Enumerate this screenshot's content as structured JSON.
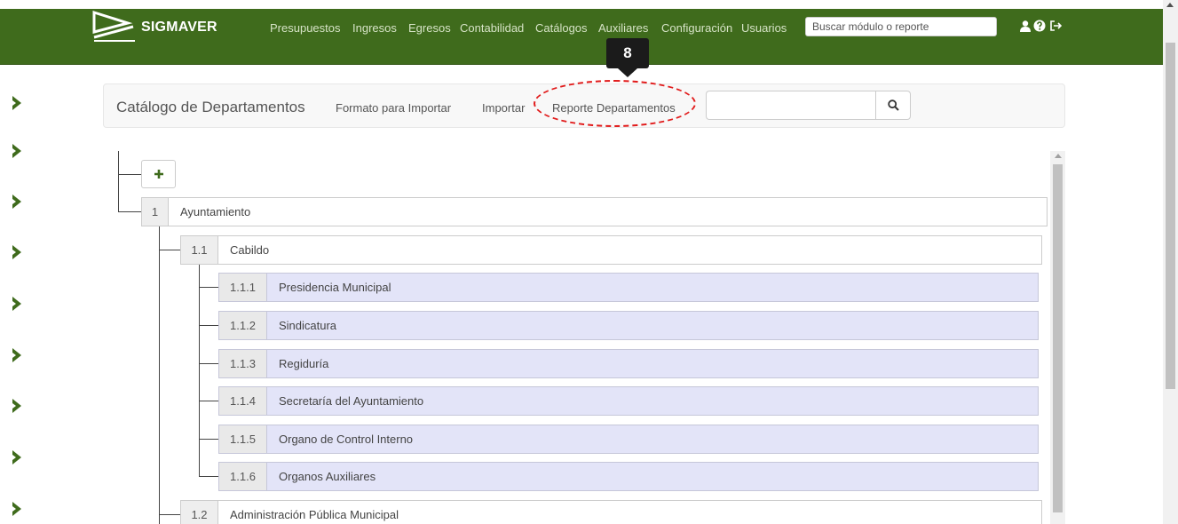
{
  "app": {
    "brand": "SIGMAVER",
    "nav": [
      "Presupuestos",
      "Ingresos",
      "Egresos",
      "Contabilidad",
      "Catálogos",
      "Auxiliares",
      "Configuración",
      "Usuarios"
    ],
    "search_placeholder": "Buscar módulo o reporte",
    "icons": [
      "user-icon",
      "help-icon",
      "logout-icon"
    ],
    "accent_color": "#3f6b1c"
  },
  "subheader": {
    "title": "Catálogo de Departamentos",
    "links": [
      "Formato para Importar",
      "Importar",
      "Reporte Departamentos"
    ],
    "search_value": "",
    "search_icon": "search-icon"
  },
  "annotation": {
    "step": "8",
    "highlight_color": "#e11b1b"
  },
  "tree": {
    "add_icon": "plus-icon",
    "nodes": [
      {
        "num": "1",
        "label": "Ayuntamiento"
      },
      {
        "num": "1.1",
        "label": "Cabildo"
      },
      {
        "num": "1.1.1",
        "label": "Presidencia Municipal"
      },
      {
        "num": "1.1.2",
        "label": "Sindicatura"
      },
      {
        "num": "1.1.3",
        "label": "Regiduría"
      },
      {
        "num": "1.1.4",
        "label": "Secretaría del Ayuntamiento"
      },
      {
        "num": "1.1.5",
        "label": "Organo de Control Interno"
      },
      {
        "num": "1.1.6",
        "label": "Organos Auxiliares"
      },
      {
        "num": "1.2",
        "label": "Administración Pública Municipal"
      }
    ],
    "leaf_color": "#e3e4f8"
  }
}
